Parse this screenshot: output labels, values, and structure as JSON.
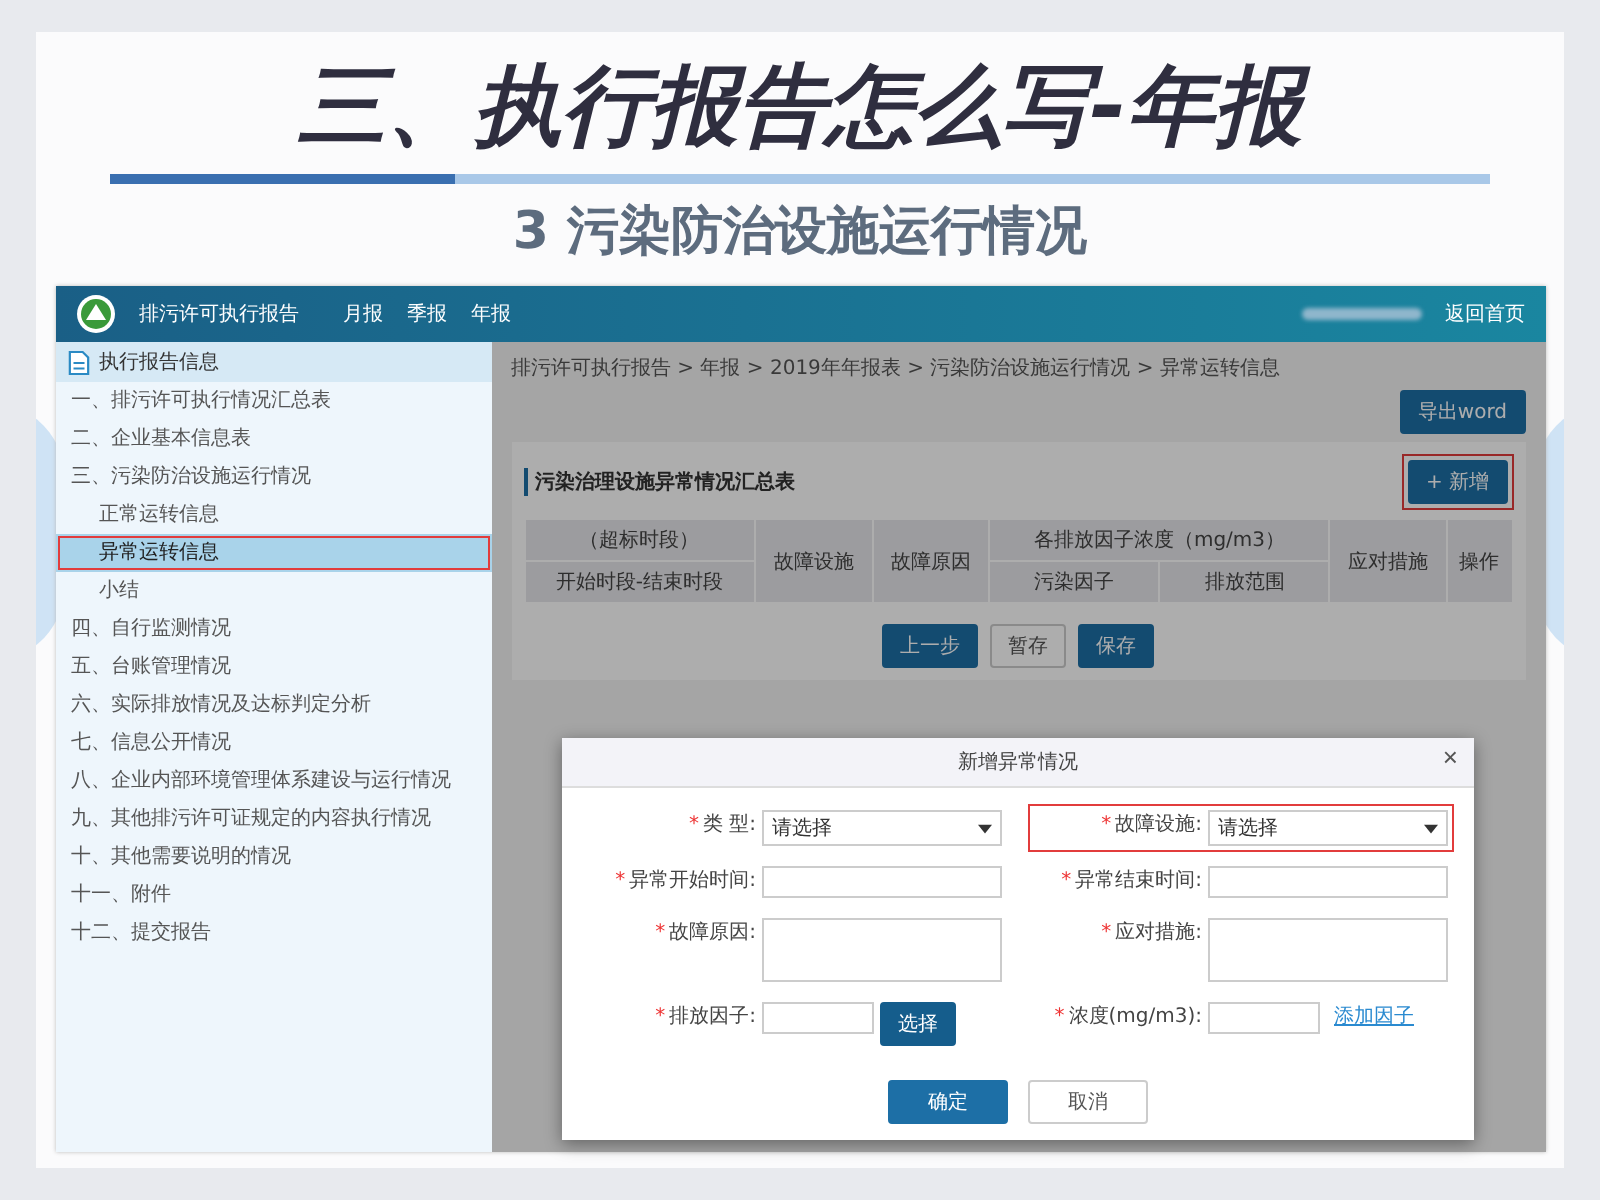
{
  "slide": {
    "title": "三、执行报告怎么写-年报",
    "subtitle": "3 污染防治设施运行情况"
  },
  "app": {
    "header": {
      "app_name": "排污许可执行报告",
      "nav": [
        "月报",
        "季报",
        "年报"
      ],
      "home_link": "返回首页"
    },
    "sidebar": {
      "title": "执行报告信息",
      "items": [
        {
          "label": "一、排污许可执行情况汇总表",
          "selected": false,
          "annotated": false
        },
        {
          "label": "二、企业基本信息表",
          "selected": false,
          "annotated": false
        },
        {
          "label": "三、污染防治设施运行情况",
          "selected": false,
          "annotated": false,
          "children": [
            {
              "label": "正常运转信息",
              "selected": false,
              "annotated": false
            },
            {
              "label": "异常运转信息",
              "selected": true,
              "annotated": true
            },
            {
              "label": "小结",
              "selected": false,
              "annotated": false
            }
          ]
        },
        {
          "label": "四、自行监测情况",
          "selected": false,
          "annotated": false
        },
        {
          "label": "五、台账管理情况",
          "selected": false,
          "annotated": false
        },
        {
          "label": "六、实际排放情况及达标判定分析",
          "selected": false,
          "annotated": false
        },
        {
          "label": "七、信息公开情况",
          "selected": false,
          "annotated": false
        },
        {
          "label": "八、企业内部环境管理体系建设与运行情况",
          "selected": false,
          "annotated": false
        },
        {
          "label": "九、其他排污许可证规定的内容执行情况",
          "selected": false,
          "annotated": false
        },
        {
          "label": "十、其他需要说明的情况",
          "selected": false,
          "annotated": false
        },
        {
          "label": "十一、附件",
          "selected": false,
          "annotated": false
        },
        {
          "label": "十二、提交报告",
          "selected": false,
          "annotated": false
        }
      ]
    },
    "breadcrumb": "排污许可执行报告 > 年报 > 2019年年报表 > 污染防治设施运行情况 > 异常运转信息",
    "export_button": "导出word",
    "panel": {
      "title": "污染治理设施异常情况汇总表",
      "add_button": {
        "label": "+ 新增",
        "annotated": true
      },
      "columns": [
        {
          "label": "（超标时段）",
          "sublabel": "开始时段-结束时段"
        },
        {
          "label": "故障设施"
        },
        {
          "label": "故障原因"
        },
        {
          "label": "各排放因子浓度（mg/m3）",
          "children": [
            "污染因子",
            "排放范围"
          ]
        },
        {
          "label": "应对措施"
        },
        {
          "label": "操作"
        }
      ],
      "buttons": [
        {
          "label": "上一步",
          "kind": "primary"
        },
        {
          "label": "暂存",
          "kind": "plain"
        },
        {
          "label": "保存",
          "kind": "primary"
        }
      ]
    },
    "dialog": {
      "title": "新增异常情况",
      "close": "×",
      "fields": [
        {
          "kind": "select",
          "mark": "*",
          "label": "类 型:",
          "value": "请选择",
          "annotated": false
        },
        {
          "kind": "select",
          "mark": "*",
          "label": "故障设施:",
          "value": "请选择",
          "annotated": true
        },
        {
          "kind": "text",
          "mark": "*",
          "label": "异常开始时间:",
          "annotated": false
        },
        {
          "kind": "text",
          "mark": "*",
          "label": "异常结束时间:",
          "annotated": false
        },
        {
          "kind": "textarea",
          "mark": "*",
          "label": "故障原因:",
          "annotated": false
        },
        {
          "kind": "textarea",
          "mark": "*",
          "label": "应对措施:",
          "annotated": false
        },
        {
          "kind": "picker",
          "mark": "*",
          "label": "排放因子:",
          "button": "选择",
          "annotated": false
        },
        {
          "kind": "linked",
          "mark": "*",
          "label": "浓度(mg/m3):",
          "link": "添加因子",
          "annotated": false
        }
      ],
      "buttons": [
        {
          "label": "确定",
          "kind": "primary"
        },
        {
          "label": "取消",
          "kind": "plain"
        }
      ]
    }
  }
}
